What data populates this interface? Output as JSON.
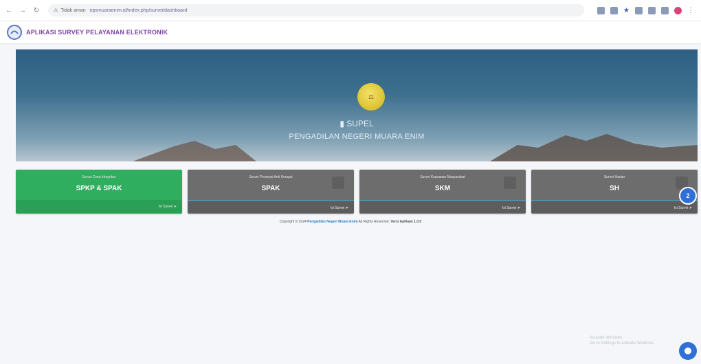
{
  "browser": {
    "security_label": "Tidak aman",
    "url": "epsmuaraenim.id/index.php/survei/dashboard"
  },
  "app": {
    "title": "APLIKASI SURVEY PELAYANAN ELEKTRONIK"
  },
  "hero": {
    "brand": "SUPEL",
    "subtitle": "PENGADILAN NEGERI MUARA ENIM"
  },
  "cards": [
    {
      "caption": "Survei Zona Integritas",
      "title": "SPKP & SPAK",
      "action": "Isi Survei",
      "color": "#2fae5f"
    },
    {
      "caption": "Survei Persepsi Anti Korupsi",
      "title": "SPAK",
      "action": "Isi Survei",
      "color": "#6d6d6d"
    },
    {
      "caption": "Survei Kepuasan Masyarakat",
      "title": "SKM",
      "action": "Isi Survei",
      "color": "#6d6d6d"
    },
    {
      "caption": "Survei Harian",
      "title": "SH",
      "action": "Isi Survei",
      "color": "#6d6d6d"
    }
  ],
  "footer": {
    "prefix": "Copyright © 2024",
    "org": "Pengadilan Negeri Muara Enim",
    "middle": "All Rights Reserved.",
    "version": "Versi Aplikasi",
    "version_value": "1.0.0"
  },
  "activation": {
    "line1": "Activate Windows",
    "line2": "Go to Settings to activate Windows."
  },
  "fab_label": "2"
}
